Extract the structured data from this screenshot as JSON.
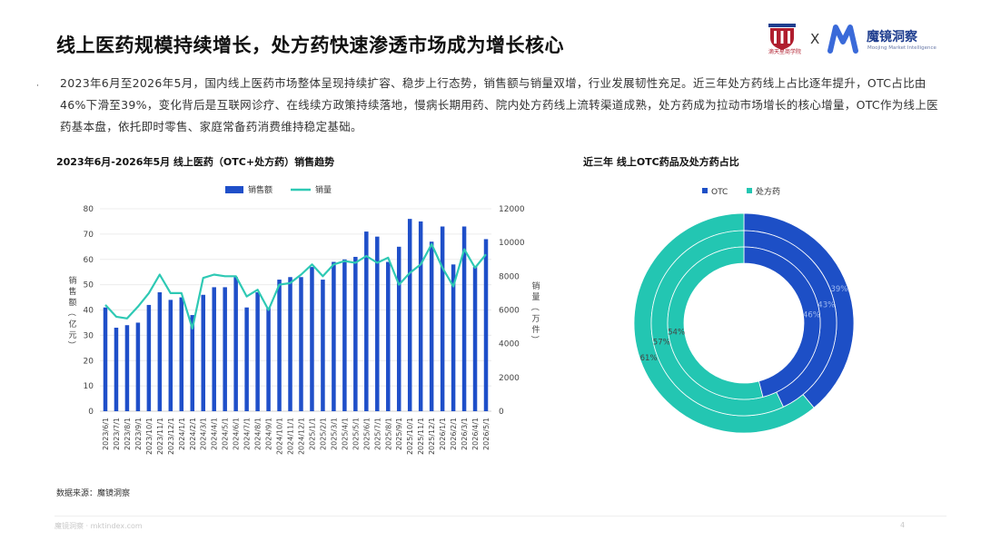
{
  "page": {
    "title": "线上医药规模持续增长，处方药快速渗透市场成为增长核心",
    "bullet": "·",
    "paragraph": "2023年6月至2026年5月，国内线上医药市场整体呈现持续扩容、稳步上行态势，销售额与销量双增，行业发展韧性充足。近三年处方药线上占比逐年提升，OTC占比由46%下滑至39%，变化背后是互联网诊疗、在线续方政策持续落地，慢病长期用药、院内处方药线上流转渠道成熟，处方药成为拉动市场增长的核心增量，OTC作为线上医药基本盘，依托即时零售、家庭常备药消费维持稳定基础。",
    "source": "数据来源：魔镜洞察",
    "footer": "魔镜洞察 · mktindex.com",
    "page_number": "4"
  },
  "logos": {
    "partner_name": "滴天星商学院",
    "separator": "X",
    "brand_name": "魔镜洞察",
    "brand_sub": "Moojing Market Intelligence"
  },
  "colors": {
    "bar": "#1f4fc9",
    "line": "#2ec9b4",
    "otc": "#1d4fc6",
    "rx": "#23c6b2",
    "brand": "#1f3e8f",
    "partner": "#b01e2e"
  },
  "chart_data": [
    {
      "type": "bar",
      "title": "2023年6月-2026年5月 线上医药（OTC+处方药）销售趋势",
      "ylabel": "销售额（亿元）",
      "y2label": "销量（万件）",
      "ylim": [
        0,
        80
      ],
      "y2lim": [
        0,
        12000
      ],
      "yticks": [
        "0",
        "10",
        "20",
        "30",
        "40",
        "50",
        "60",
        "70",
        "80"
      ],
      "y2ticks": [
        "0",
        "2000",
        "4000",
        "6000",
        "8000",
        "10000",
        "12000"
      ],
      "legend_position": "top",
      "categories": [
        "2023/6/1",
        "2023/7/1",
        "2023/8/1",
        "2023/9/1",
        "2023/10/1",
        "2023/11/1",
        "2023/12/1",
        "2024/1/1",
        "2024/2/1",
        "2024/3/1",
        "2024/4/1",
        "2024/5/1",
        "2024/6/1",
        "2024/7/1",
        "2024/8/1",
        "2024/9/1",
        "2024/10/1",
        "2024/11/1",
        "2024/12/1",
        "2025/1/1",
        "2025/2/1",
        "2025/3/1",
        "2025/4/1",
        "2025/5/1",
        "2025/6/1",
        "2025/7/1",
        "2025/8/1",
        "2025/9/1",
        "2025/10/1",
        "2025/11/1",
        "2025/12/1",
        "2026/1/1",
        "2026/2/1",
        "2026/3/1",
        "2026/4/1",
        "2026/5/1"
      ],
      "x_tick_labels": [
        "2023/6/1",
        "2023/7/1",
        "2023/8/1",
        "2023/9/1",
        "2023/10/1",
        "2023/11/1",
        "2023/12/1",
        "2024/1/1",
        "2024/2/1",
        "2024/3/1",
        "2024/4/1",
        "2024/5/1",
        "2024/6/1",
        "2024/7/1",
        "2024/8/1",
        "2024/9/1",
        "2024/10/1",
        "2024/11/1",
        "2024/12/1",
        "2025/1/1",
        "2025/2/1",
        "2025/3/1",
        "2025/4/1",
        "2025/5/1",
        "2025/6/1",
        "2025/7/1",
        "2025/8/1",
        "2025/9/1",
        "2025/10/1",
        "2025/11/1",
        "2025/12/1",
        "2026/1/1",
        "2026/2/1",
        "2026/3/1",
        "2026/4/1",
        "2026/5/1"
      ],
      "series": [
        {
          "name": "销售额",
          "axis": "left",
          "kind": "bar",
          "values": [
            41,
            33,
            34,
            35,
            42,
            47,
            44,
            45,
            38,
            46,
            49,
            49,
            53,
            41,
            47,
            41,
            52,
            53,
            53,
            57,
            52,
            59,
            60,
            61,
            71,
            69,
            59,
            65,
            76,
            75,
            67,
            73,
            58,
            73,
            57,
            68
          ]
        },
        {
          "name": "销量",
          "axis": "right",
          "kind": "line",
          "values": [
            6300,
            5600,
            5500,
            6200,
            7000,
            8100,
            7000,
            7000,
            4900,
            7900,
            8100,
            8000,
            8000,
            6800,
            7200,
            6000,
            7500,
            7600,
            8100,
            8700,
            8000,
            8700,
            8900,
            8800,
            9200,
            8800,
            9100,
            7500,
            8200,
            8700,
            9900,
            8500,
            7400,
            9600,
            8500,
            9300
          ]
        }
      ]
    },
    {
      "type": "pie",
      "title": "近三年 线上OTC药品及处方药占比",
      "legend_position": "top",
      "legend": [
        "OTC",
        "处方药"
      ],
      "rings": [
        {
          "period": "outer",
          "values": [
            39,
            61
          ],
          "labels": [
            "39%",
            "61%"
          ]
        },
        {
          "period": "middle",
          "values": [
            43,
            57
          ],
          "labels": [
            "43%",
            "57%"
          ]
        },
        {
          "period": "inner",
          "values": [
            46,
            54
          ],
          "labels": [
            "46%",
            "54%"
          ]
        }
      ]
    }
  ]
}
